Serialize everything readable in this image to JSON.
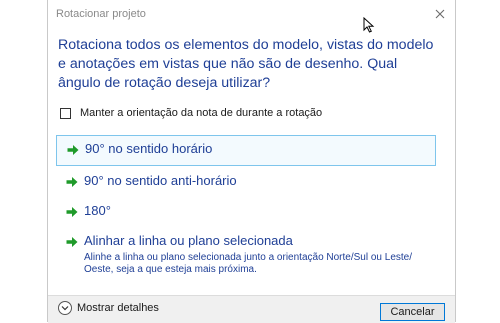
{
  "window": {
    "title": "Rotacionar projeto"
  },
  "instruction": "Rotaciona todos os elementos do modelo, vistas do modelo e anotações em vistas que não são de desenho.  Qual ângulo de rotação deseja utilizar?",
  "checkbox": {
    "label": "Manter a orientação da nota de durante a rotação",
    "checked": false
  },
  "commands": [
    {
      "label": "90° no sentido horário",
      "selected": true
    },
    {
      "label": "90° no sentido anti-horário"
    },
    {
      "label": "180°"
    },
    {
      "label": "Alinhar a linha ou plano selecionada",
      "note": "Alinhe a linha ou plano selecionada junto a orientação Norte/Sul ou Leste/ Oeste, seja a que esteja mais próxima."
    }
  ],
  "footer": {
    "details_label": "Mostrar detalhes",
    "cancel_label": "Cancelar"
  },
  "colors": {
    "instruction_text": "#1f3f96",
    "arrow_green": "#1f9a2a",
    "selection_border": "#7ec5ec",
    "button_border": "#0078d7"
  },
  "icons": [
    "close-icon",
    "green-arrow-icon",
    "chevron-down-icon",
    "mouse-cursor-icon"
  ]
}
